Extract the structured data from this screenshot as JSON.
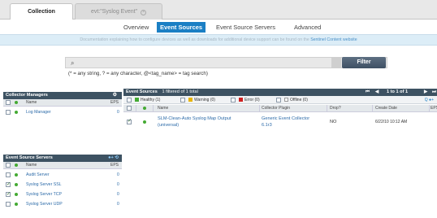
{
  "tabs": [
    {
      "label": "Collection"
    },
    {
      "label": "evt:\"Syslog Event\""
    }
  ],
  "subnav": {
    "items": [
      "Overview",
      "Event Sources",
      "Event Source Servers",
      "Advanced"
    ]
  },
  "doc": {
    "text": "Documentation explaining how to configure devices as well as downloads for additional device support can be found on the ",
    "link": "Sentinel Content website"
  },
  "search": {
    "value": "",
    "filter_label": "Filter",
    "hint": "(* = any string, ? = any character, @<tag_name> = tag search)"
  },
  "collector_managers": {
    "title": "Collector Managers",
    "col_name": "Name",
    "col_eps": "EPS",
    "rows": [
      {
        "name": "Log Manager",
        "eps": "0"
      }
    ]
  },
  "event_source_servers": {
    "title": "Event Source Servers",
    "col_name": "Name",
    "col_eps": "EPS",
    "rows": [
      {
        "name": "Audit Server",
        "eps": "0",
        "checked": false
      },
      {
        "name": "Syslog Server SSL",
        "eps": "0",
        "checked": true
      },
      {
        "name": "Syslog Server TCP",
        "eps": "0",
        "checked": true
      },
      {
        "name": "Syslog Server UDP",
        "eps": "0",
        "checked": false
      }
    ]
  },
  "event_sources": {
    "title": "Event Sources",
    "summary": "1 filtered of 1 total",
    "pager": "1 to 1 of 1",
    "legend": {
      "healthy": "Healthy (1)",
      "warning": "Warning (0)",
      "error": "Error (0)",
      "offline": "Offline (0)"
    },
    "columns": [
      "Name",
      "Collector Plugin",
      "Drop?",
      "Create Date",
      "EPS"
    ],
    "rows": [
      {
        "name_line1": "SLM-Clean-Auto Syslog Map Output",
        "name_line2": "(universal)",
        "plugin_line1": "Generic Event Collector",
        "plugin_line2": "6.1r3",
        "drop": "NO",
        "create_date": "6/22/10 10:12 AM"
      }
    ]
  },
  "colors": {
    "accent": "#1b7fc4",
    "panel_header": "#3d5262",
    "healthy": "#44aa33",
    "warning": "#e8b400",
    "error": "#d02020"
  }
}
